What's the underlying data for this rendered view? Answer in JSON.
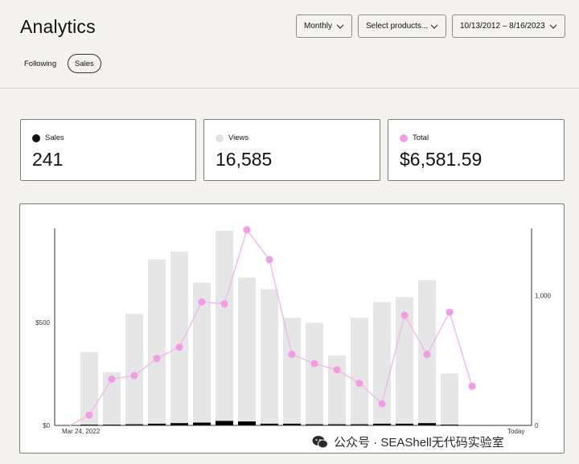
{
  "page": {
    "title": "Analytics"
  },
  "controls": {
    "period": "Monthly",
    "products": "Select products...",
    "date_range": "10/13/2012 – 8/16/2023"
  },
  "tabs": [
    {
      "label": "Following",
      "active": false
    },
    {
      "label": "Sales",
      "active": true
    }
  ],
  "stats": [
    {
      "label": "Sales",
      "value": "241",
      "color": "#111111"
    },
    {
      "label": "Views",
      "value": "16,585",
      "color": "#e3e3e3"
    },
    {
      "label": "Total",
      "value": "$6,581.59",
      "color": "#f29ce6"
    }
  ],
  "chart_data": {
    "type": "bar",
    "left_axis": {
      "ticks": [
        "$0",
        "$500"
      ],
      "values": [
        0,
        500
      ]
    },
    "right_axis": {
      "ticks": [
        "0",
        "1,000"
      ],
      "values": [
        0,
        1000
      ]
    },
    "x_start_label": "Mar 24, 2022",
    "x_end_label": "Today",
    "views": [
      565,
      410,
      860,
      1280,
      1340,
      1100,
      1500,
      1140,
      1050,
      830,
      790,
      540,
      830,
      950,
      990,
      1120,
      400,
      0,
      0,
      0
    ],
    "sales": [
      0,
      0,
      2,
      3,
      4,
      5,
      8,
      7,
      3,
      3,
      2,
      2,
      2,
      3,
      3,
      4,
      0,
      0,
      0,
      0
    ],
    "revenue": [
      0,
      50,
      225,
      242,
      325,
      380,
      600,
      590,
      950,
      805,
      345,
      300,
      270,
      205,
      105,
      535,
      345,
      550,
      190
    ],
    "colors": {
      "views": "#e6e6e6",
      "sales": "#000000",
      "total": "#f29ce6",
      "total_line": "#f2b8ea"
    }
  },
  "watermark": {
    "text": "公众号 · SEAShell无代码实验室"
  }
}
